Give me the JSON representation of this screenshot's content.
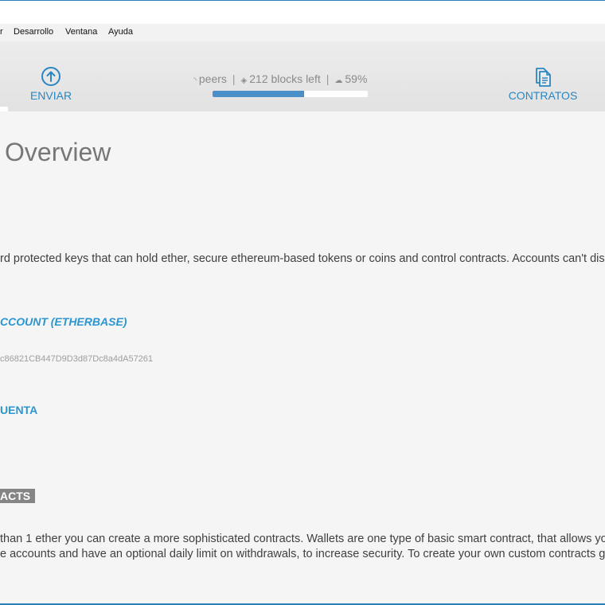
{
  "menu": [
    "r",
    "Desarrollo",
    "Ventana",
    "Ayuda"
  ],
  "toolbar": {
    "send_label": "ENVIAR",
    "contracts_label": "CONTRATOS",
    "peers_text": "peers",
    "separator": "|",
    "blocks_text": "212 blocks left",
    "percent_text": "59%",
    "progress_fraction": 0.59,
    "accent_color": "#2a86c2"
  },
  "main": {
    "title": "Overview",
    "description": "rd protected keys that can hold ether, secure ethereum-based tokens or coins and control contracts. Accounts can't displa",
    "etherbase_label": "CCOUNT (ETHERBASE)",
    "address": "c86821CB447D9D3d87Dc8a4dA57261",
    "add_account_label": "UENTA",
    "contracts_badge": "ACTS",
    "contracts_line1": "than 1 ether you can create a more sophisticated contracts. Wallets are one type of basic smart contract, that allows your",
    "contracts_line2": "e accounts and have an optional daily limit on withdrawals, to increase security. To create your own custom contracts go t"
  }
}
